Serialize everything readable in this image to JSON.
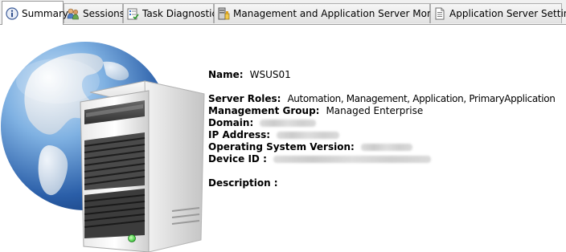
{
  "tabs": [
    {
      "label": "Summary",
      "icon": "info-icon",
      "active": true
    },
    {
      "label": "Sessions",
      "icon": "sessions-icon",
      "active": false
    },
    {
      "label": "Task Diagnostics",
      "icon": "task-diagnostics-icon",
      "active": false
    },
    {
      "label": "Management and Application Server Monitoring",
      "icon": "monitoring-icon",
      "active": false
    },
    {
      "label": "Application Server Settings",
      "icon": "settings-page-icon",
      "active": false
    }
  ],
  "summary": {
    "name_label": "Name:",
    "name_value": "WSUS01",
    "server_roles_label": "Server Roles:",
    "server_roles_value": "Automation, Management, Application, PrimaryApplication",
    "management_group_label": "Management Group:",
    "management_group_value": "Managed Enterprise",
    "domain_label": "Domain:",
    "ip_label": "IP Address:",
    "os_label": "Operating System Version:",
    "device_id_label": "Device ID :",
    "description_label": "Description :"
  },
  "images": {
    "globe": "globe-icon",
    "server": "server-tower-icon",
    "status_light_color": "#36c236"
  }
}
